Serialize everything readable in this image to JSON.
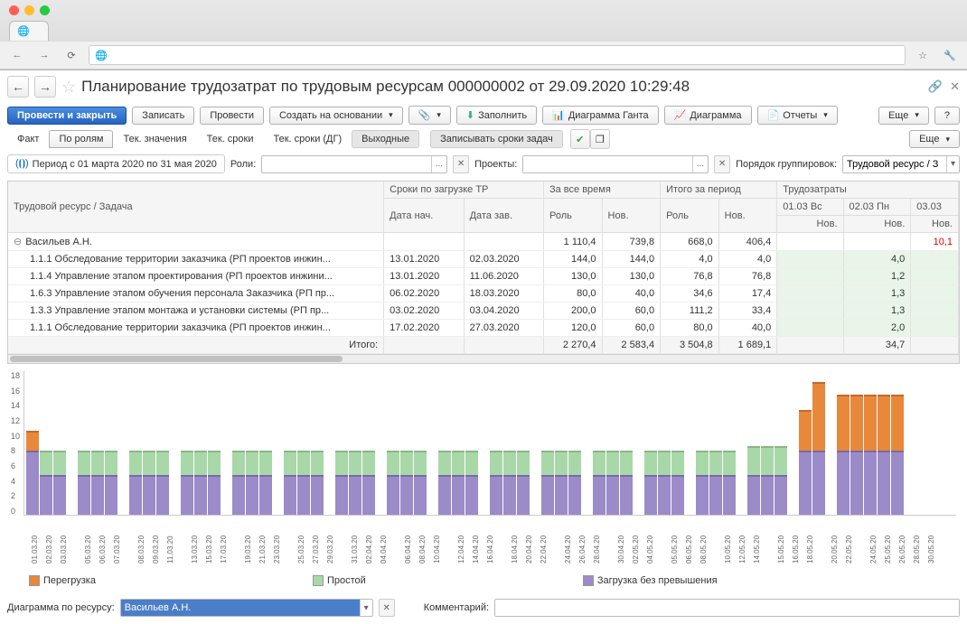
{
  "browser": {
    "tab_globe": "🌐"
  },
  "header": {
    "title": "Планирование трудозатрат по трудовым ресурсам 000000002 от 29.09.2020 10:29:48"
  },
  "toolbar": {
    "submit_close": "Провести и закрыть",
    "write": "Записать",
    "submit": "Провести",
    "create_based": "Создать на основании",
    "fill": "Заполнить",
    "gantt": "Диаграмма Ганта",
    "diagram": "Диаграмма",
    "reports": "Отчеты",
    "more": "Еще",
    "help": "?"
  },
  "tabs": {
    "fact": "Факт",
    "by_roles": "По ролям",
    "cur_values": "Тек. значения",
    "cur_dates": "Тек. сроки",
    "cur_dates_dg": "Тек. сроки (ДГ)",
    "weekends": "Выходные",
    "write_task_dates": "Записывать сроки задач",
    "more": "Еще"
  },
  "filters": {
    "period_label": "Период с 01 марта 2020 по 31 мая 2020",
    "roles_label": "Роли:",
    "projects_label": "Проекты:",
    "group_order_label": "Порядок группировок:",
    "group_order_value": "Трудовой ресурс / З"
  },
  "table": {
    "h_resource": "Трудовой ресурс / Задача",
    "h_dates_group": "Сроки по загрузке ТР",
    "h_date_start": "Дата нач.",
    "h_date_end": "Дата зав.",
    "h_alltime": "За все время",
    "h_role": "Роль",
    "h_new": "Нов.",
    "h_period_total": "Итого за период",
    "h_labor": "Трудозатраты",
    "h_d1": "01.03 Вс",
    "h_d2": "02.03 Пн",
    "h_d3": "03.03",
    "resource_name": "Васильев А.Н.",
    "rows": [
      {
        "name": "1.1.1 Обследование территории заказчика (РП проектов инжин...",
        "ds": "13.01.2020",
        "de": "02.03.2020",
        "r": "144,0",
        "n": "144,0",
        "pr": "4,0",
        "pn": "4,0",
        "v2": "4,0"
      },
      {
        "name": "1.1.4 Управление этапом проектирования (РП проектов инжини...",
        "ds": "13.01.2020",
        "de": "11.06.2020",
        "r": "130,0",
        "n": "130,0",
        "pr": "76,8",
        "pn": "76,8",
        "v2": "1,2"
      },
      {
        "name": "1.6.3 Управление этапом обучения персонала Заказчика (РП пр...",
        "ds": "06.02.2020",
        "de": "18.03.2020",
        "r": "80,0",
        "n": "40,0",
        "pr": "34,6",
        "pn": "17,4",
        "v2": "1,3"
      },
      {
        "name": "1.3.3 Управление этапом монтажа и установки системы (РП пр...",
        "ds": "03.02.2020",
        "de": "03.04.2020",
        "r": "200,0",
        "n": "60,0",
        "pr": "111,2",
        "pn": "33,4",
        "v2": "1,3"
      },
      {
        "name": "1.1.1 Обследование территории заказчика (РП проектов инжин...",
        "ds": "17.02.2020",
        "de": "27.03.2020",
        "r": "120,0",
        "n": "60,0",
        "pr": "80,0",
        "pn": "40,0",
        "v2": "2,0"
      }
    ],
    "summary": {
      "r": "1 110,4",
      "n": "739,8",
      "pr": "668,0",
      "pn": "406,4",
      "v3": "10,1"
    },
    "footer_label": "Итого:",
    "footer": {
      "r": "2 270,4",
      "n": "2 583,4",
      "pr": "3 504,8",
      "pn": "1 689,1",
      "v2": "34,7"
    }
  },
  "chart_data": {
    "type": "bar",
    "ylim": [
      0,
      18
    ],
    "yticks": [
      0,
      2,
      4,
      6,
      8,
      10,
      12,
      14,
      16,
      18
    ],
    "legend": {
      "overload": "Перегрузка",
      "idle": "Простой",
      "normal": "Загрузка без превышения"
    },
    "groups": [
      {
        "dates": [
          "01.03.20",
          "02.03.20",
          "03.03.20"
        ],
        "bars": [
          {
            "p": 8,
            "g": 0,
            "o": 2.5
          },
          {
            "p": 5,
            "g": 3,
            "o": 0
          },
          {
            "p": 5,
            "g": 3,
            "o": 0
          }
        ]
      },
      {
        "dates": [
          "05.03.20",
          "06.03.20",
          "07.03.20"
        ],
        "bars": [
          {
            "p": 5,
            "g": 3,
            "o": 0
          },
          {
            "p": 5,
            "g": 3,
            "o": 0
          },
          {
            "p": 5,
            "g": 3,
            "o": 0
          }
        ]
      },
      {
        "dates": [
          "08.03.20",
          "09.03.20",
          "11.03.20"
        ],
        "bars": [
          {
            "p": 5,
            "g": 3,
            "o": 0
          },
          {
            "p": 5,
            "g": 3,
            "o": 0
          },
          {
            "p": 5,
            "g": 3,
            "o": 0
          }
        ]
      },
      {
        "dates": [
          "13.03.20",
          "15.03.20",
          "17.03.20"
        ],
        "bars": [
          {
            "p": 5,
            "g": 3,
            "o": 0
          },
          {
            "p": 5,
            "g": 3,
            "o": 0
          },
          {
            "p": 5,
            "g": 3,
            "o": 0
          }
        ]
      },
      {
        "dates": [
          "19.03.20",
          "21.03.20",
          "23.03.20"
        ],
        "bars": [
          {
            "p": 5,
            "g": 3,
            "o": 0
          },
          {
            "p": 5,
            "g": 3,
            "o": 0
          },
          {
            "p": 5,
            "g": 3,
            "o": 0
          }
        ]
      },
      {
        "dates": [
          "25.03.20",
          "27.03.20",
          "29.03.20"
        ],
        "bars": [
          {
            "p": 5,
            "g": 3,
            "o": 0
          },
          {
            "p": 5,
            "g": 3,
            "o": 0
          },
          {
            "p": 5,
            "g": 3,
            "o": 0
          }
        ]
      },
      {
        "dates": [
          "31.03.20",
          "02.04.20",
          "04.04.20"
        ],
        "bars": [
          {
            "p": 5,
            "g": 3,
            "o": 0
          },
          {
            "p": 5,
            "g": 3,
            "o": 0
          },
          {
            "p": 5,
            "g": 3,
            "o": 0
          }
        ]
      },
      {
        "dates": [
          "06.04.20",
          "08.04.20",
          "10.04.20"
        ],
        "bars": [
          {
            "p": 5,
            "g": 3,
            "o": 0
          },
          {
            "p": 5,
            "g": 3,
            "o": 0
          },
          {
            "p": 5,
            "g": 3,
            "o": 0
          }
        ]
      },
      {
        "dates": [
          "12.04.20",
          "14.04.20",
          "16.04.20"
        ],
        "bars": [
          {
            "p": 5,
            "g": 3,
            "o": 0
          },
          {
            "p": 5,
            "g": 3,
            "o": 0
          },
          {
            "p": 5,
            "g": 3,
            "o": 0
          }
        ]
      },
      {
        "dates": [
          "18.04.20",
          "20.04.20",
          "22.04.20"
        ],
        "bars": [
          {
            "p": 5,
            "g": 3,
            "o": 0
          },
          {
            "p": 5,
            "g": 3,
            "o": 0
          },
          {
            "p": 5,
            "g": 3,
            "o": 0
          }
        ]
      },
      {
        "dates": [
          "24.04.20",
          "26.04.20",
          "28.04.20"
        ],
        "bars": [
          {
            "p": 5,
            "g": 3,
            "o": 0
          },
          {
            "p": 5,
            "g": 3,
            "o": 0
          },
          {
            "p": 5,
            "g": 3,
            "o": 0
          }
        ]
      },
      {
        "dates": [
          "30.04.20",
          "02.05.20",
          "04.05.20"
        ],
        "bars": [
          {
            "p": 5,
            "g": 3,
            "o": 0
          },
          {
            "p": 5,
            "g": 3,
            "o": 0
          },
          {
            "p": 5,
            "g": 3,
            "o": 0
          }
        ]
      },
      {
        "dates": [
          "05.05.20",
          "06.05.20",
          "08.05.20"
        ],
        "bars": [
          {
            "p": 5,
            "g": 3,
            "o": 0
          },
          {
            "p": 5,
            "g": 3,
            "o": 0
          },
          {
            "p": 5,
            "g": 3,
            "o": 0
          }
        ]
      },
      {
        "dates": [
          "10.05.20",
          "12.05.20",
          "14.05.20"
        ],
        "bars": [
          {
            "p": 5,
            "g": 3,
            "o": 0
          },
          {
            "p": 5,
            "g": 3,
            "o": 0
          },
          {
            "p": 5,
            "g": 3,
            "o": 0
          }
        ]
      },
      {
        "dates": [
          "15.05.20",
          "16.05.20",
          "18.05.20"
        ],
        "bars": [
          {
            "p": 5,
            "g": 3.5,
            "o": 0
          },
          {
            "p": 5,
            "g": 3.5,
            "o": 0
          },
          {
            "p": 5,
            "g": 3.5,
            "o": 0
          }
        ]
      },
      {
        "dates": [
          "20.05.20",
          "22.05.20"
        ],
        "bars": [
          {
            "p": 8,
            "g": 0,
            "o": 5
          },
          {
            "p": 8,
            "g": 0,
            "o": 8.5
          }
        ]
      },
      {
        "dates": [
          "24.05.20",
          "25.05.20",
          "26.05.20",
          "28.05.20",
          "30.05.20"
        ],
        "bars": [
          {
            "p": 8,
            "g": 0,
            "o": 7
          },
          {
            "p": 8,
            "g": 0,
            "o": 7
          },
          {
            "p": 8,
            "g": 0,
            "o": 7
          },
          {
            "p": 8,
            "g": 0,
            "o": 7
          },
          {
            "p": 8,
            "g": 0,
            "o": 7
          }
        ]
      }
    ]
  },
  "footer": {
    "diagram_by_label": "Диаграмма по ресурсу:",
    "resource_value": "Васильев А.Н.",
    "comment_label": "Комментарий:"
  }
}
